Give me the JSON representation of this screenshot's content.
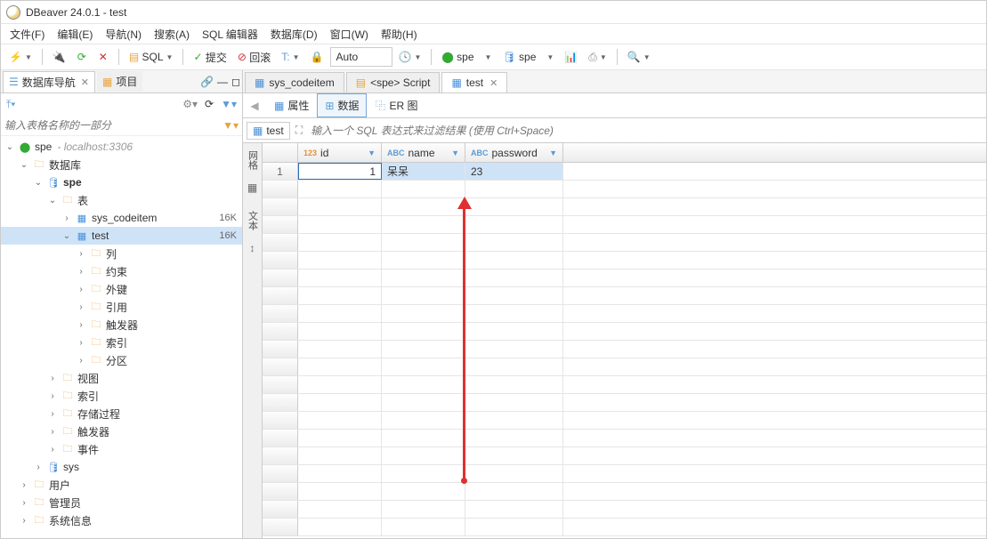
{
  "title": "DBeaver 24.0.1 - test",
  "menu": [
    "文件(F)",
    "编辑(E)",
    "导航(N)",
    "搜索(A)",
    "SQL 编辑器",
    "数据库(D)",
    "窗口(W)",
    "帮助(H)"
  ],
  "toolbar": {
    "sql_label": "SQL",
    "commit_label": "提交",
    "rollback_label": "回滚",
    "auto_label": "Auto",
    "conn1": "spe",
    "conn2": "spe"
  },
  "sidebar": {
    "tab1": "数据库导航",
    "tab2": "项目",
    "filter_placeholder": "输入表格名称的一部分",
    "conn_name": "spe",
    "conn_host": "- localhost:3306",
    "n_databases": "数据库",
    "n_db": "spe",
    "n_tables": "表",
    "t1": "sys_codeitem",
    "t1_size": "16K",
    "t2": "test",
    "t2_size": "16K",
    "sub": [
      "列",
      "约束",
      "外键",
      "引用",
      "触发器",
      "索引",
      "分区"
    ],
    "other": [
      "视图",
      "索引",
      "存储过程",
      "触发器",
      "事件"
    ],
    "sys": "sys",
    "bottom": [
      "用户",
      "管理员",
      "系统信息"
    ]
  },
  "editor": {
    "tabs": [
      {
        "label": "sys_codeitem",
        "active": false
      },
      {
        "label": "<spe> Script",
        "active": false
      },
      {
        "label": "test",
        "active": true
      }
    ],
    "subtabs": {
      "props": "属性",
      "data": "数据",
      "er": "ER 图"
    },
    "table_name": "test",
    "filter_placeholder": "输入一个 SQL 表达式来过滤结果 (使用 Ctrl+Space)",
    "columns": [
      {
        "name": "id",
        "type": "num"
      },
      {
        "name": "name",
        "type": "txt"
      },
      {
        "name": "password",
        "type": "txt"
      }
    ],
    "rows": [
      {
        "num": "1",
        "id": "1",
        "name": "呆呆",
        "password": "23"
      }
    ],
    "vtabs": {
      "grid": "网格",
      "text": "文本"
    }
  }
}
